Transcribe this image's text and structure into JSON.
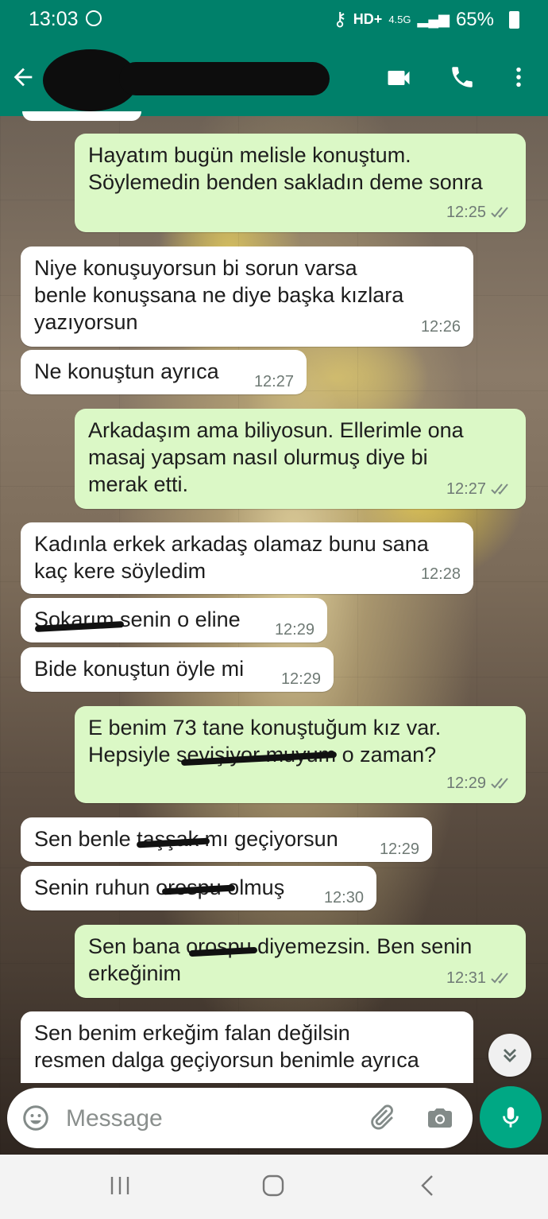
{
  "status_bar": {
    "time": "13:03",
    "network": "4.5G",
    "battery": "65%"
  },
  "header": {
    "contact_name": ""
  },
  "messages": [
    {
      "dir": "out",
      "text": "Hayatım bugün melisle konuştum.\nSöylemedin benden sakladın deme sonra",
      "time": "12:25"
    },
    {
      "dir": "in",
      "text": "Niye konuşuyorsun bi sorun varsa\nbenle konuşsana ne diye başka kızlara\nyazıyorsun",
      "time": "12:26"
    },
    {
      "dir": "in",
      "text": "Ne konuştun ayrıca",
      "time": "12:27"
    },
    {
      "dir": "out",
      "text": "Arkadaşım ama biliyosun. Ellerimle ona\nmasaj yapsam nasıl olurmuş diye bi\nmerak etti.",
      "time": "12:27"
    },
    {
      "dir": "in",
      "text": "Kadınla erkek arkadaş olamaz bunu sana\nkaç kere söyledim",
      "time": "12:28"
    },
    {
      "dir": "in",
      "text": "Sokarım senin o eline",
      "time": "12:29"
    },
    {
      "dir": "in",
      "text": "Bide konuştun öyle mi",
      "time": "12:29"
    },
    {
      "dir": "out",
      "text": "E benim 73 tane konuştuğum kız var.\nHepsiyle sevişiyor muyum o zaman?",
      "time": "12:29"
    },
    {
      "dir": "in",
      "text": "Sen benle taşşak mı geçiyorsun",
      "time": "12:29"
    },
    {
      "dir": "in",
      "text": "Senin ruhun orospu olmuş",
      "time": "12:30"
    },
    {
      "dir": "out",
      "text": "Sen bana orospu diyemezsin. Ben senin\nerkeğinim",
      "time": "12:31"
    },
    {
      "dir": "in",
      "text": "Sen benim erkeğim falan değilsin\nresmen dalga geçiyorsun benimle ayrıca",
      "time": ""
    }
  ],
  "input": {
    "placeholder": "Message"
  },
  "colors": {
    "header": "#00806a",
    "outgoing": "#dbf8c6",
    "incoming": "#ffffff",
    "mic": "#00a884",
    "tick": "#7d8a84"
  },
  "icons": [
    "back-arrow-icon",
    "video-call-icon",
    "voice-call-icon",
    "more-vert-icon",
    "emoji-icon",
    "attach-icon",
    "camera-icon",
    "mic-icon",
    "chevron-double-down-icon",
    "double-check-icon"
  ]
}
